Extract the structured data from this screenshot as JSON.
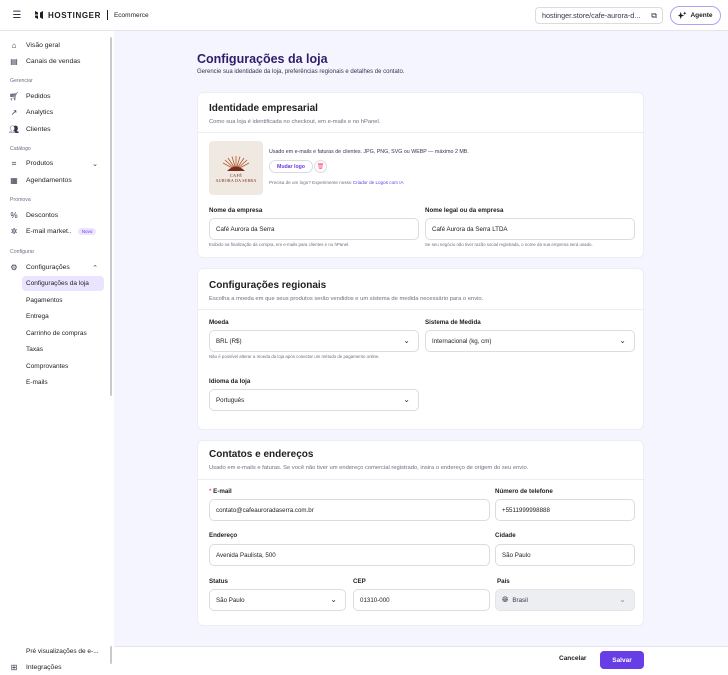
{
  "header": {
    "brand": "HOSTINGER",
    "product": "Ecommerce",
    "url": "hostinger.store/cafe-aurora-d...",
    "agent_label": "Agente"
  },
  "sidebar": {
    "top_items": [
      {
        "label": "Visão geral",
        "icon": "home-icon"
      },
      {
        "label": "Canais de vendas",
        "icon": "store-icon"
      }
    ],
    "sections": {
      "gerenciar": "Gerenciar",
      "catalogo": "Catálogo",
      "promova": "Promova",
      "configurar": "Configurar"
    },
    "gerenciar_items": [
      {
        "label": "Pedidos"
      },
      {
        "label": "Analytics"
      },
      {
        "label": "Clientes"
      }
    ],
    "catalogo_items": [
      {
        "label": "Produtos"
      },
      {
        "label": "Agendamentos"
      }
    ],
    "promova_items": [
      {
        "label": "Descontos"
      },
      {
        "label": "E-mail market..",
        "badge": "Novo"
      }
    ],
    "config_label": "Configurações",
    "config_subitems": [
      {
        "label": "Configurações da loja"
      },
      {
        "label": "Pagamentos"
      },
      {
        "label": "Entrega"
      },
      {
        "label": "Carrinho de compras"
      },
      {
        "label": "Taxas"
      },
      {
        "label": "Comprovantes"
      },
      {
        "label": "E-mails"
      }
    ],
    "bottom_items": [
      {
        "label": "Pré visualizações de e-..."
      },
      {
        "label": "Integrações"
      }
    ]
  },
  "page": {
    "title": "Configurações da loja",
    "subtitle": "Gerencie sua identidade da loja, preferências regionais e detalhes de contato."
  },
  "identity": {
    "title": "Identidade empresarial",
    "desc": "Como sua loja é identificada no checkout, em e-mails e no hPanel.",
    "logo_text_1": "CAFÉ",
    "logo_text_2": "AURORA DA SERRA",
    "logo_hint": "Usado em e-mails e faturas de clientes. JPG, PNG, SVG ou WEBP — máximo 2 MB.",
    "change_logo": "Mudar logo",
    "logo_maker_prefix": "Precisa de um logo? Experimente nosso",
    "logo_maker_link": "Criador de Logos com IA",
    "company_name_label": "Nome da empresa",
    "company_name_value": "Café Aurora da Serra",
    "company_name_hint": "Exibido na finalização da compra, em e-mails para clientes e no hPanel.",
    "legal_name_label": "Nome legal ou da empresa",
    "legal_name_value": "Café Aurora da Serra LTDA",
    "legal_name_hint": "Se seu negócio não tiver razão social registrada, o nome da sua empresa será usado."
  },
  "regional": {
    "title": "Configurações regionais",
    "desc": "Escolha a moeda em que seus produtos serão vendidos e um sistema de medida necessário para o envio.",
    "currency_label": "Moeda",
    "currency_value": "BRL (R$)",
    "currency_hint": "Não é possível alterar a moeda da loja após conectar um método de pagamento online.",
    "measure_label": "Sistema de Medida",
    "measure_value": "Internacional (kg, cm)",
    "language_label": "Idioma da loja",
    "language_value": "Português"
  },
  "contacts": {
    "title": "Contatos e endereços",
    "desc": "Usado em e-mails e faturas. Se você não tiver um endereço comercial registrado, insira o endereço de origem do seu envio.",
    "email_required": "*",
    "email_label": "E-mail",
    "email_value": "contato@cafeauroradaserra.com.br",
    "phone_label": "Número de telefone",
    "phone_value": "+5511999998888",
    "address_label": "Endereço",
    "address_value": "Avenida Paulista, 500",
    "city_label": "Cidade",
    "city_value": "São Paulo",
    "state_label": "Status",
    "state_value": "São Paulo",
    "cep_label": "CEP",
    "cep_value": "01310-000",
    "country_label": "País",
    "country_value": "Brasil"
  },
  "footer": {
    "cancel": "Cancelar",
    "save": "Salvar"
  },
  "colors": {
    "accent": "#673de6",
    "title": "#2f1c6a",
    "active_bg": "#ebe4ff"
  }
}
